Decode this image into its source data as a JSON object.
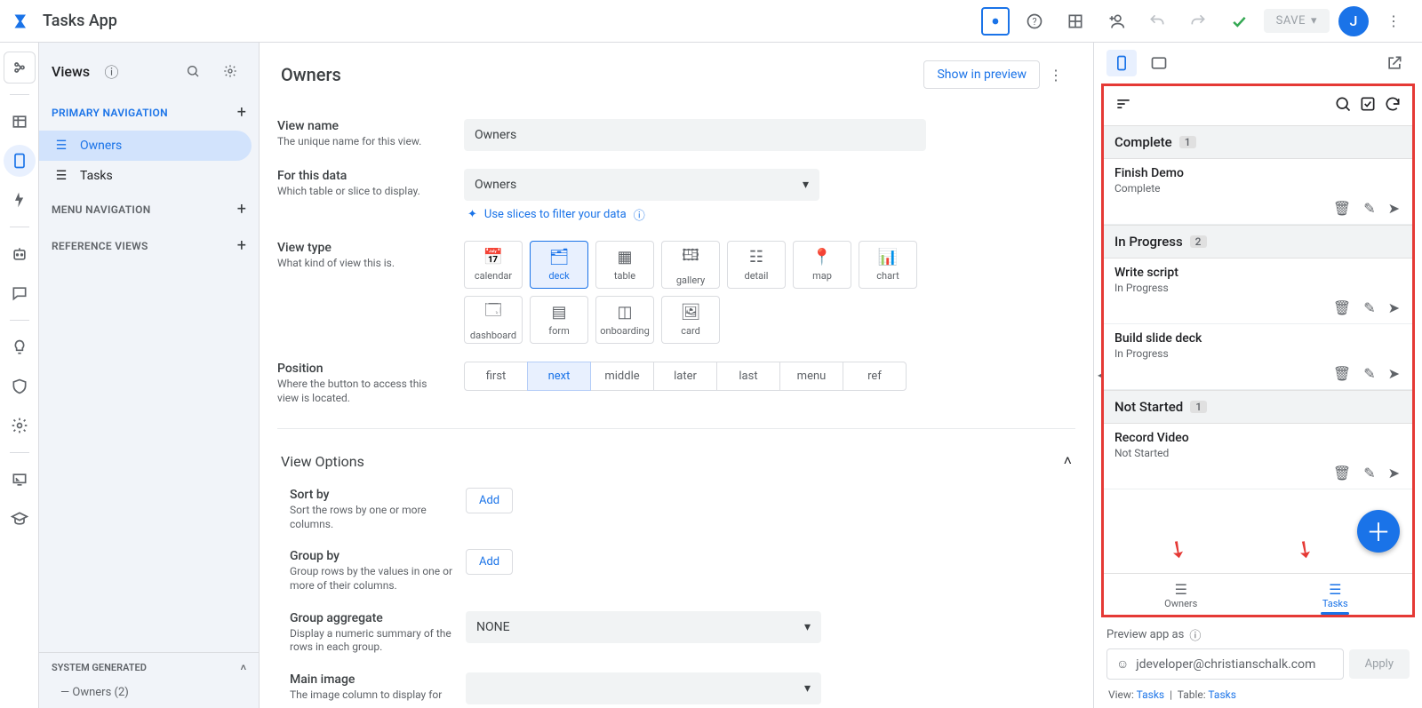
{
  "header": {
    "app_name": "Tasks App",
    "save_label": "SAVE",
    "avatar_letter": "J"
  },
  "views_panel": {
    "title": "Views",
    "sections": {
      "primary": "PRIMARY NAVIGATION",
      "menu": "MENU NAVIGATION",
      "reference": "REFERENCE VIEWS",
      "system": "SYSTEM GENERATED"
    },
    "nav_items": [
      {
        "label": "Owners",
        "active": true
      },
      {
        "label": "Tasks",
        "active": false
      }
    ],
    "sysgen_sub": "Owners (2)"
  },
  "center": {
    "title": "Owners",
    "show_preview": "Show in preview",
    "view_name": {
      "label": "View name",
      "desc": "The unique name for this view.",
      "value": "Owners"
    },
    "for_data": {
      "label": "For this data",
      "desc": "Which table or slice to display.",
      "value": "Owners",
      "hint": "Use slices to filter your data"
    },
    "view_type": {
      "label": "View type",
      "desc": "What kind of view this is.",
      "tiles_row1": [
        "calendar",
        "deck",
        "table",
        "gallery",
        "detail",
        "map",
        "chart"
      ],
      "tiles_row2": [
        "dashboard",
        "form",
        "onboarding",
        "card"
      ],
      "active": "deck"
    },
    "position": {
      "label": "Position",
      "desc": "Where the button to access this view is located.",
      "options": [
        "first",
        "next",
        "middle",
        "later",
        "last",
        "menu",
        "ref"
      ],
      "active": "next"
    },
    "view_options": {
      "title": "View Options",
      "sort_by": {
        "label": "Sort by",
        "desc": "Sort the rows by one or more columns.",
        "btn": "Add"
      },
      "group_by": {
        "label": "Group by",
        "desc": "Group rows by the values in one or more of their columns.",
        "btn": "Add"
      },
      "group_aggregate": {
        "label": "Group aggregate",
        "desc": "Display a numeric summary of the rows in each group.",
        "value": "NONE"
      },
      "main_image": {
        "label": "Main image",
        "desc": "The image column to display for"
      }
    }
  },
  "preview": {
    "groups": [
      {
        "name": "Complete",
        "count": "1",
        "items": [
          {
            "title": "Finish Demo",
            "sub": "Complete"
          }
        ]
      },
      {
        "name": "In Progress",
        "count": "2",
        "items": [
          {
            "title": "Write script",
            "sub": "In Progress"
          },
          {
            "title": "Build slide deck",
            "sub": "In Progress"
          }
        ]
      },
      {
        "name": "Not Started",
        "count": "1",
        "items": [
          {
            "title": "Record Video",
            "sub": "Not Started"
          }
        ]
      }
    ],
    "bottom_nav": [
      {
        "label": "Owners",
        "active": false
      },
      {
        "label": "Tasks",
        "active": true
      }
    ],
    "footer": {
      "preview_as": "Preview app as",
      "email": "jdeveloper@christianschalk.com",
      "apply": "Apply",
      "status_view_lbl": "View:",
      "status_view": "Tasks",
      "status_table_lbl": "Table:",
      "status_table": "Tasks"
    }
  }
}
